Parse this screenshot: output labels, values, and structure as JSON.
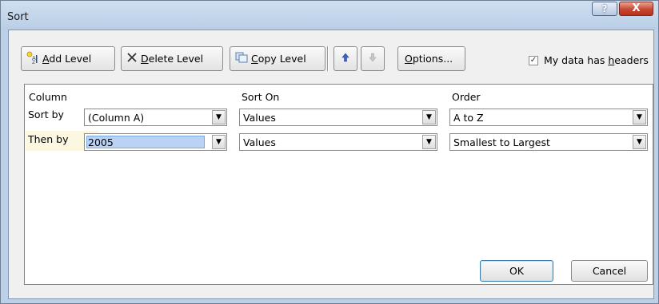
{
  "window": {
    "title": "Sort",
    "help_glyph": "?",
    "close_glyph": "X"
  },
  "toolbar": {
    "add_level": {
      "first": "A",
      "rest": "dd Level",
      "icon": "add-level-icon"
    },
    "delete_level": {
      "first": "D",
      "rest": "elete Level",
      "icon": "delete-x-icon"
    },
    "copy_level": {
      "first": "C",
      "rest": "opy Level",
      "icon": "copy-icon"
    },
    "move_up_icon": "arrow-up-icon",
    "move_down_icon": "arrow-down-icon",
    "options": {
      "first": "O",
      "rest": "ptions..."
    },
    "headers_checkbox": {
      "label_pre": "My data has ",
      "label_ul": "h",
      "label_post": "eaders",
      "checked": true
    }
  },
  "grid": {
    "headers": {
      "column": "Column",
      "sort_on": "Sort On",
      "order": "Order"
    },
    "rows": [
      {
        "label": "Sort by",
        "column": "(Column A)",
        "sort_on": "Values",
        "order": "A to Z"
      },
      {
        "label": "Then by",
        "column": "2005",
        "sort_on": "Values",
        "order": "Smallest to Largest",
        "selected": true
      }
    ]
  },
  "buttons": {
    "ok": "OK",
    "cancel": "Cancel"
  },
  "colors": {
    "title_bg": "#c4d6ec",
    "client_bg": "#f0f0f0",
    "selection": "#bad3f4",
    "close_red": "#c74631"
  }
}
